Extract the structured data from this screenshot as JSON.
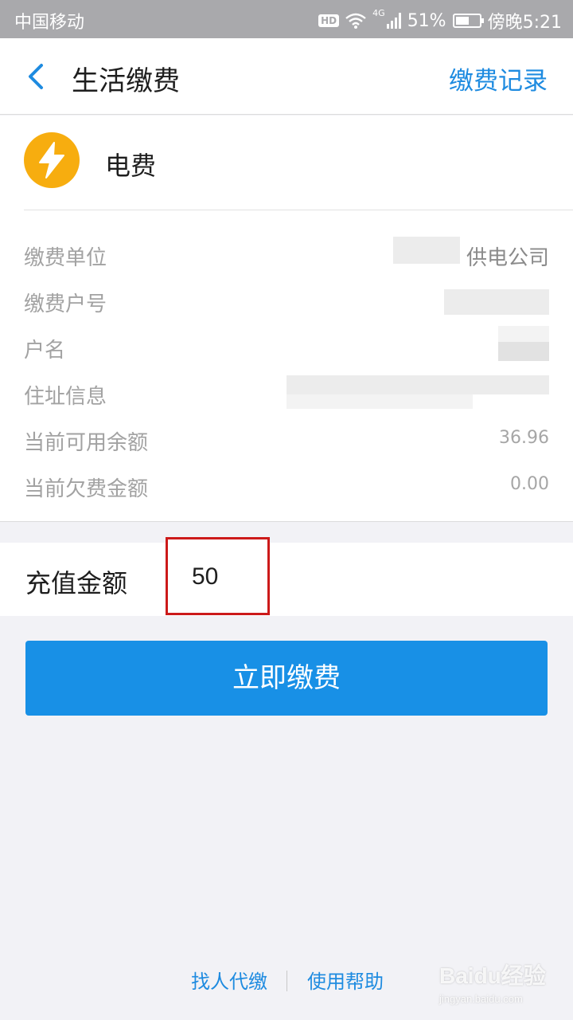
{
  "status_bar": {
    "carrier": "中国移动",
    "hd": "HD",
    "network": "4G",
    "battery": "51%",
    "time": "傍晚5:21"
  },
  "nav": {
    "title": "生活缴费",
    "record": "缴费记录"
  },
  "bill": {
    "name": "电费",
    "icon": "lightning-icon",
    "rows": [
      {
        "label": "缴费单位",
        "value": "供电公司"
      },
      {
        "label": "缴费户号",
        "value": ""
      },
      {
        "label": "户名",
        "value": ""
      },
      {
        "label": "住址信息",
        "value": ""
      },
      {
        "label": "当前可用余额",
        "value": "36.96"
      },
      {
        "label": "当前欠费金额",
        "value": "0.00"
      }
    ]
  },
  "recharge": {
    "label": "充值金额",
    "amount": "50"
  },
  "pay_button": "立即缴费",
  "footer": {
    "proxy_pay": "找人代缴",
    "help": "使用帮助"
  },
  "watermark": {
    "brand": "Baidu经验",
    "url": "jingyan.baidu.com"
  },
  "colors": {
    "accent": "#1890e6",
    "link": "#1e8be0",
    "icon_bg": "#f7ad0f",
    "highlight_border": "#cc1a1a"
  }
}
